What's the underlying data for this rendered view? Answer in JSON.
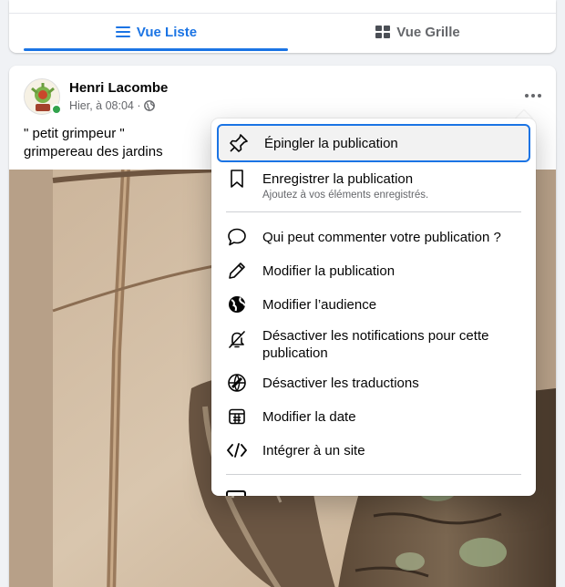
{
  "view_switch": {
    "list_label": "Vue Liste",
    "grid_label": "Vue Grille",
    "active": "list"
  },
  "post": {
    "author": "Henri Lacombe",
    "time": "Hier, à 08:04 ·",
    "audience_icon": "globe-icon",
    "caption_line1": "\" petit grimpeur \"",
    "caption_line2": "grimpereau des jardins",
    "online": true
  },
  "menu": {
    "items": [
      {
        "icon": "pin-icon",
        "label": "Épingler la publication",
        "focused": true
      },
      {
        "icon": "bookmark-icon",
        "label": "Enregistrer la publication",
        "sublabel": "Ajoutez à vos éléments enregistrés."
      },
      {
        "icon": "comment-icon",
        "label": "Qui peut commenter votre publication ?"
      },
      {
        "icon": "pencil-icon",
        "label": "Modifier la publication"
      },
      {
        "icon": "globe-icon",
        "label": "Modifier l’audience"
      },
      {
        "icon": "bell-off-icon",
        "label": "Désactiver les notifications pour cette publication"
      },
      {
        "icon": "translate-icon",
        "label": "Désactiver les traductions"
      },
      {
        "icon": "calendar-icon",
        "label": "Modifier la date"
      },
      {
        "icon": "code-icon",
        "label": "Intégrer à un site"
      }
    ]
  },
  "colors": {
    "accent": "#1b74e4",
    "online": "#31a24c",
    "secondary_text": "#65676b",
    "background": "#f0f2f5"
  }
}
